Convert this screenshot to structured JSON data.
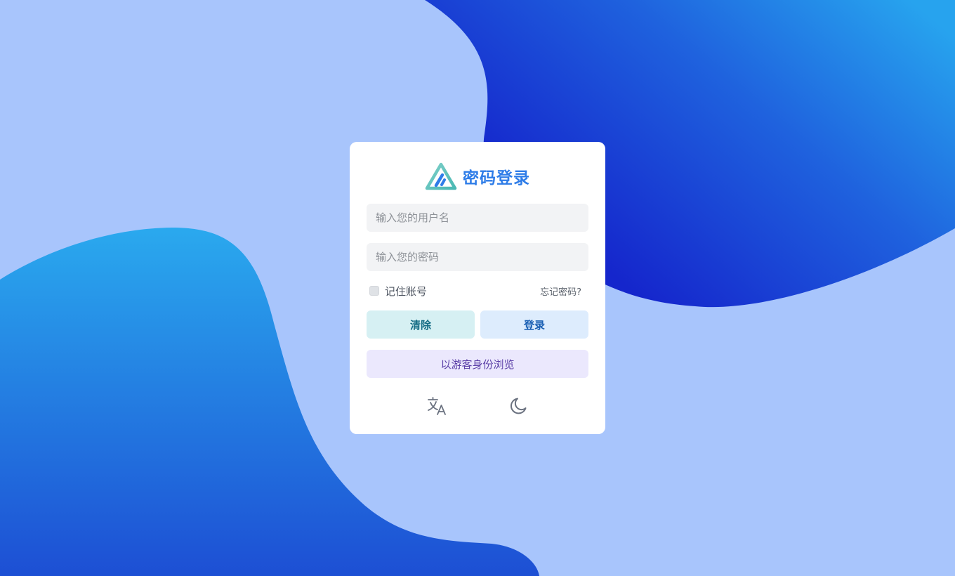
{
  "login": {
    "title": "密码登录",
    "username_placeholder": "输入您的用户名",
    "password_placeholder": "输入您的密码",
    "remember_label": "记住账号",
    "forgot_label": "忘记密码?",
    "clear_label": "清除",
    "login_label": "登录",
    "guest_label": "以游客身份浏览"
  },
  "icons": {
    "logo": "brand-logo-icon",
    "translate": "translate-icon",
    "theme": "moon-icon"
  },
  "colors": {
    "accent": "#2f7de8",
    "background": "#a8c5fc"
  }
}
